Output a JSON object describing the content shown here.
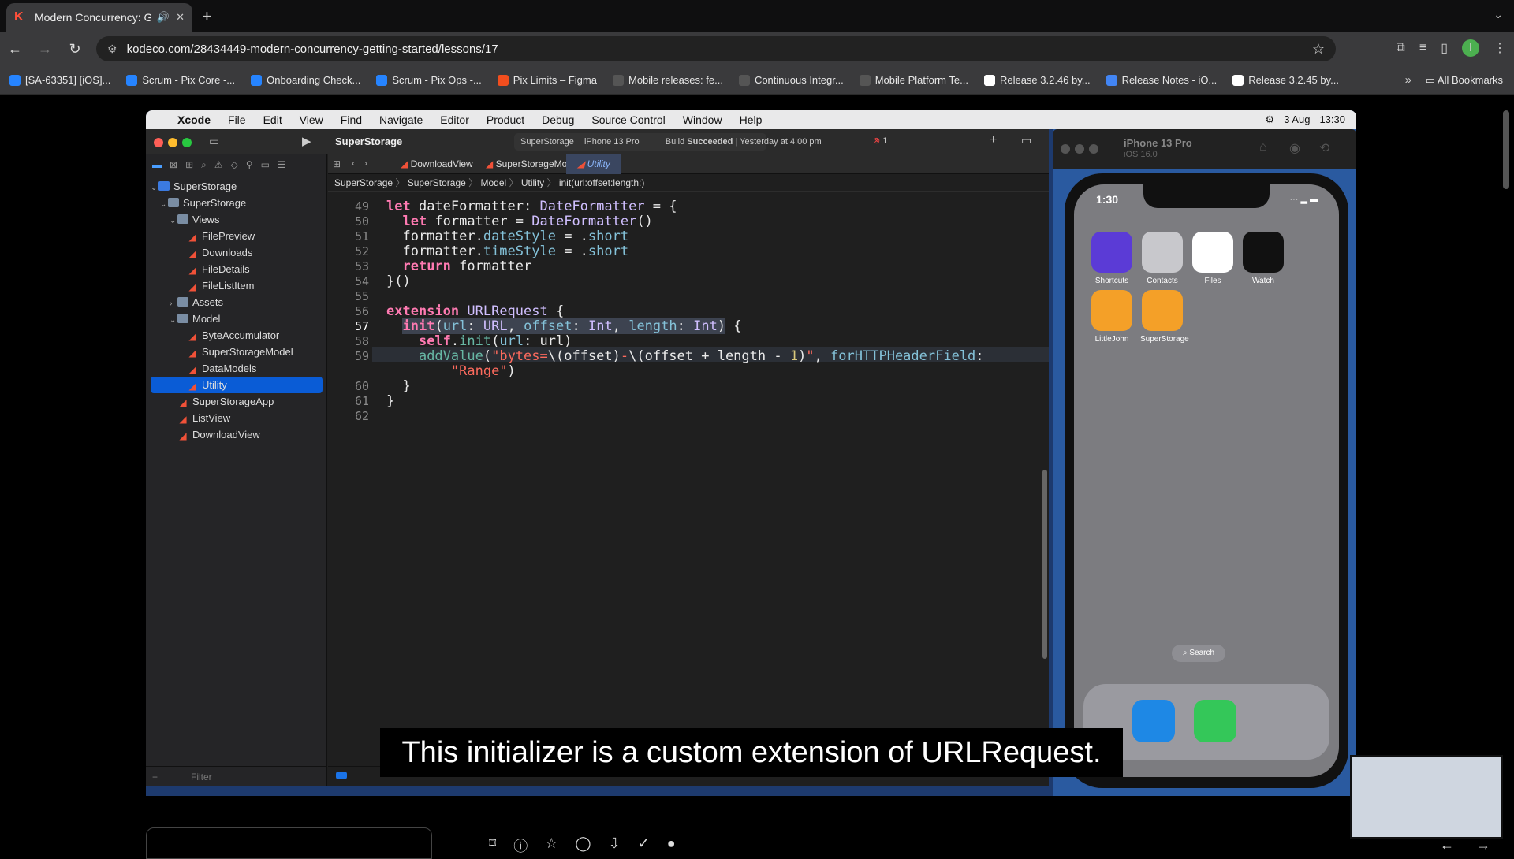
{
  "browser": {
    "tab_title": "Modern Concurrency: Ge",
    "tab_icon": "kodeco-icon",
    "url": "kodeco.com/28434449-modern-concurrency-getting-started/lessons/17",
    "bookmarks": [
      {
        "label": "[SA-63351] [iOS]...",
        "color": "#2684ff"
      },
      {
        "label": "Scrum - Pix Core -...",
        "color": "#2684ff"
      },
      {
        "label": "Onboarding Check...",
        "color": "#2684ff"
      },
      {
        "label": "Scrum - Pix Ops -...",
        "color": "#2684ff"
      },
      {
        "label": "Pix Limits – Figma",
        "color": "#f24e1e"
      },
      {
        "label": "Mobile releases: fe...",
        "color": "#555555"
      },
      {
        "label": "Continuous Integr...",
        "color": "#555555"
      },
      {
        "label": "Mobile Platform Te...",
        "color": "#555555"
      },
      {
        "label": "Release 3.2.46 by...",
        "color": "#ffffff"
      },
      {
        "label": "Release Notes - iO...",
        "color": "#4285f4"
      },
      {
        "label": "Release 3.2.45 by...",
        "color": "#ffffff"
      }
    ],
    "all_bookmarks": "All Bookmarks",
    "profile_initial": "I"
  },
  "mac": {
    "menus": [
      "Xcode",
      "File",
      "Edit",
      "View",
      "Find",
      "Navigate",
      "Editor",
      "Product",
      "Debug",
      "Source Control",
      "Window",
      "Help"
    ],
    "date": "3 Aug",
    "time": "13:30"
  },
  "xcode": {
    "project": "SuperStorage",
    "scheme": "SuperStorage",
    "device": "iPhone 13 Pro",
    "build_prefix": "Build",
    "build_status": "Succeeded",
    "build_time": "| Yesterday at 4:00 pm",
    "error_count": "1",
    "tabs": [
      "DownloadView",
      "SuperStorageModel",
      "Utility"
    ],
    "jumpbar": [
      "SuperStorage",
      "SuperStorage",
      "Model",
      "Utility",
      "init(url:offset:length:)"
    ],
    "tree": [
      {
        "label": "SuperStorage",
        "depth": 0,
        "kind": "proj",
        "caret": "⌄"
      },
      {
        "label": "SuperStorage",
        "depth": 1,
        "kind": "folder",
        "caret": "⌄"
      },
      {
        "label": "Views",
        "depth": 2,
        "kind": "folder",
        "caret": "⌄"
      },
      {
        "label": "FilePreview",
        "depth": 3,
        "kind": "swift",
        "caret": ""
      },
      {
        "label": "Downloads",
        "depth": 3,
        "kind": "swift",
        "caret": ""
      },
      {
        "label": "FileDetails",
        "depth": 3,
        "kind": "swift",
        "caret": ""
      },
      {
        "label": "FileListItem",
        "depth": 3,
        "kind": "swift",
        "caret": ""
      },
      {
        "label": "Assets",
        "depth": 2,
        "kind": "folder",
        "caret": "›"
      },
      {
        "label": "Model",
        "depth": 2,
        "kind": "folder",
        "caret": "⌄"
      },
      {
        "label": "ByteAccumulator",
        "depth": 3,
        "kind": "swift",
        "caret": ""
      },
      {
        "label": "SuperStorageModel",
        "depth": 3,
        "kind": "swift",
        "caret": ""
      },
      {
        "label": "DataModels",
        "depth": 3,
        "kind": "swift",
        "caret": ""
      },
      {
        "label": "Utility",
        "depth": 3,
        "kind": "swift",
        "caret": "",
        "selected": true
      },
      {
        "label": "SuperStorageApp",
        "depth": 2,
        "kind": "swift",
        "caret": ""
      },
      {
        "label": "ListView",
        "depth": 2,
        "kind": "swift",
        "caret": ""
      },
      {
        "label": "DownloadView",
        "depth": 2,
        "kind": "swift",
        "caret": ""
      }
    ],
    "filter_placeholder": "Filter",
    "code_lines": [
      {
        "n": "49",
        "html": "<span class=\"kw\">let</span> dateFormatter: <span class=\"ty\">DateFormatter</span> = {"
      },
      {
        "n": "50",
        "html": "  <span class=\"kw\">let</span> formatter = <span class=\"ty\">DateFormatter</span>()"
      },
      {
        "n": "51",
        "html": "  formatter.<span class=\"pr\">dateStyle</span> = .<span class=\"pr\">short</span>"
      },
      {
        "n": "52",
        "html": "  formatter.<span class=\"pr\">timeStyle</span> = .<span class=\"pr\">short</span>"
      },
      {
        "n": "53",
        "html": "  <span class=\"kw\">return</span> formatter"
      },
      {
        "n": "54",
        "html": "}()"
      },
      {
        "n": "55",
        "html": ""
      },
      {
        "n": "56",
        "html": "<span class=\"kw\">extension</span> <span class=\"ty\">URLRequest</span> {"
      },
      {
        "n": "57",
        "html": "  <span class=\"hl\"><span class=\"kw\">init</span>(<span class=\"pr\">url</span>: <span class=\"ty\">URL</span>, <span class=\"pr\">offset</span>: <span class=\"ty\">Int</span>, <span class=\"pr\">length</span>: <span class=\"ty\">Int</span>)</span> {",
        "current": true
      },
      {
        "n": "58",
        "html": "    <span class=\"kw\">self</span>.<span class=\"fn\">init</span>(<span class=\"pr\">url</span>: url)"
      },
      {
        "n": "59",
        "html": "    <span class=\"fn\">addValue</span>(<span class=\"st\">\"bytes=</span>\\(offset)<span class=\"st\">-</span>\\(offset + length - <span class=\"nu\">1</span>)<span class=\"st\">\"</span>, <span class=\"pr\">forHTTPHeaderField</span>:"
      },
      {
        "n": "",
        "html": "        <span class=\"st\">\"Range\"</span>)"
      },
      {
        "n": "60",
        "html": "  }"
      },
      {
        "n": "61",
        "html": "}"
      },
      {
        "n": "62",
        "html": ""
      }
    ]
  },
  "simulator": {
    "device_name": "iPhone 13 Pro",
    "ios": "iOS 16.0",
    "clock": "1:30",
    "apps": [
      {
        "label": "Shortcuts",
        "color": "#5b3bd6"
      },
      {
        "label": "Contacts",
        "color": "#c8c8cc"
      },
      {
        "label": "Files",
        "color": "#ffffff"
      },
      {
        "label": "Watch",
        "color": "#111111"
      },
      {
        "label": "LittleJohn",
        "color": "#f4a028"
      },
      {
        "label": "SuperStorage",
        "color": "#f4a028"
      }
    ],
    "search_label": "Search"
  },
  "caption": "This initializer is a custom extension of URLRequest."
}
